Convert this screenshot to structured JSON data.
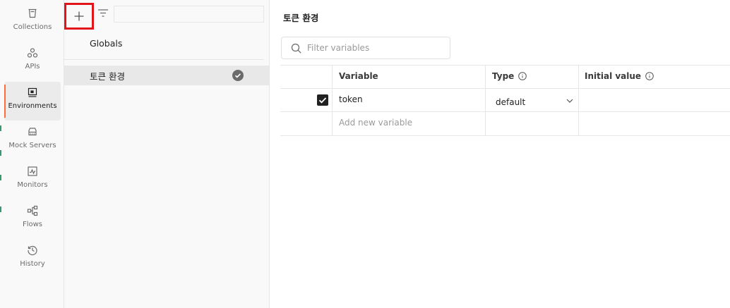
{
  "sidebar": {
    "items": [
      {
        "id": "collections",
        "label": "Collections",
        "icon": "trash-bin-icon"
      },
      {
        "id": "apis",
        "label": "APIs",
        "icon": "apis-icon"
      },
      {
        "id": "environments",
        "label": "Environments",
        "icon": "environments-icon",
        "active": true
      },
      {
        "id": "mock-servers",
        "label": "Mock Servers",
        "icon": "server-icon"
      },
      {
        "id": "monitors",
        "label": "Monitors",
        "icon": "monitor-icon"
      },
      {
        "id": "flows",
        "label": "Flows",
        "icon": "flows-icon"
      },
      {
        "id": "history",
        "label": "History",
        "icon": "history-icon"
      }
    ]
  },
  "env_panel": {
    "globals_label": "Globals",
    "environments": [
      {
        "name": "토큰 환경",
        "active": true
      }
    ]
  },
  "main": {
    "title": "토큰 환경",
    "filter_placeholder": "Filter variables",
    "table": {
      "headers": {
        "variable": "Variable",
        "type": "Type",
        "initial_value": "Initial value"
      },
      "rows": [
        {
          "enabled": true,
          "variable": "token",
          "type": "default",
          "initial_value": ""
        }
      ],
      "add_placeholder": "Add new variable"
    }
  },
  "colors": {
    "accent": "#ff6c37",
    "highlight_box": "#e3151a",
    "panel_bg": "#f9f9f9",
    "selected_bg": "#e8e8e8"
  }
}
